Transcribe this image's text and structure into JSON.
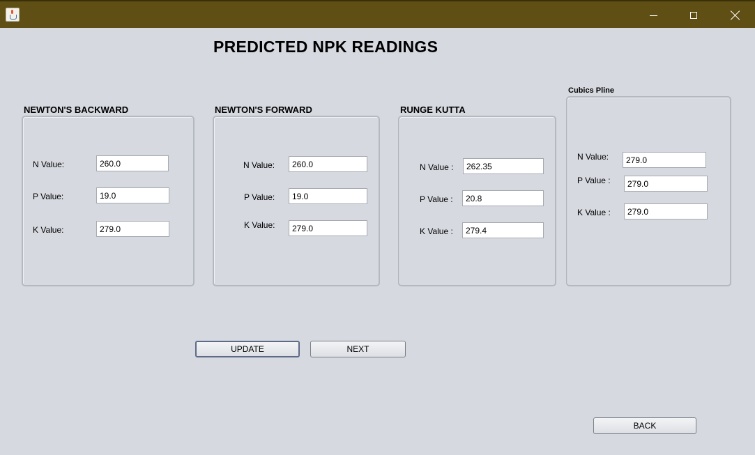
{
  "window": {
    "icon": "java-cup-icon",
    "controls": {
      "minimize": "minimize-icon",
      "maximize": "maximize-icon",
      "close": "close-icon"
    },
    "titlebar_color": "#5f4f15"
  },
  "page": {
    "title": "PREDICTED NPK READINGS"
  },
  "sections": {
    "backward": {
      "title": "NEWTON'S BACKWARD",
      "n_label": "N Value:",
      "n_value": "260.0",
      "p_label": "P Value:",
      "p_value": "19.0",
      "k_label": "K Value:",
      "k_value": "279.0"
    },
    "forward": {
      "title": "NEWTON'S FORWARD",
      "n_label": "N Value:",
      "n_value": "260.0",
      "p_label": "P Value:",
      "p_value": "19.0",
      "k_label": "K Value:",
      "k_value": "279.0"
    },
    "runge": {
      "title": "RUNGE KUTTA",
      "n_label": "N Value :",
      "n_value": "262.35",
      "p_label": "P Value :",
      "p_value": "20.8",
      "k_label": "K Value :",
      "k_value": "279.4"
    },
    "spline": {
      "title": "Cubics Pline",
      "n_label": "N Value:",
      "n_value": "279.0",
      "p_label": "P Value :",
      "p_value": "279.0",
      "k_label": "K Value :",
      "k_value": "279.0"
    }
  },
  "buttons": {
    "update": "UPDATE",
    "next": "NEXT",
    "back": "BACK"
  }
}
